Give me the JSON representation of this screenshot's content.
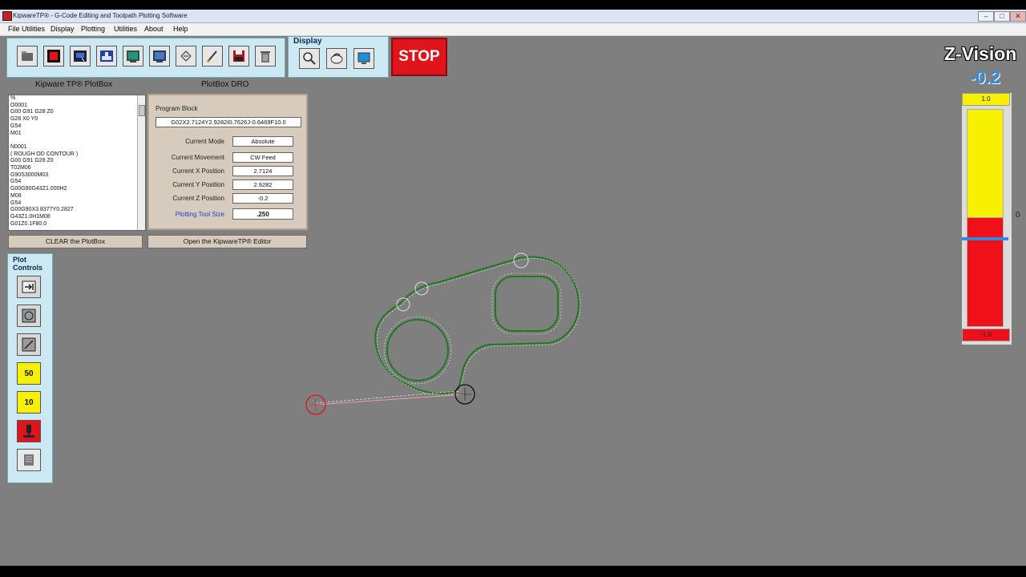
{
  "window": {
    "title": "KipwareTP® - G-Code Editing and Toolpath Plotting Software",
    "controls": [
      "–",
      "□",
      "✕"
    ]
  },
  "menu": [
    "File Utilities",
    "Display",
    "Plotting",
    "Utilities",
    "About",
    "Help"
  ],
  "toolbar": {
    "buttons": [
      "open-folder-icon",
      "red-square-icon",
      "machine-run-icon",
      "machine-view-icon",
      "monitor-icon",
      "monitor-alt-icon",
      "hand-tool-icon",
      "pen-tool-icon",
      "save-disk-icon",
      "trash-icon"
    ]
  },
  "display_group": {
    "label": "Display",
    "buttons": [
      "zoom-icon",
      "rotate-view-icon",
      "screen-icon"
    ]
  },
  "stop_button": "STOP",
  "plotbox": {
    "title": "Kipware TP® PlotBox",
    "lines": [
      "%",
      "O0001",
      "G00 G91 G28 Z0",
      "G28 X0 Y0",
      "G54",
      "M01",
      "",
      "N0001",
      "( ROUGH OD CONTOUR )",
      "G00 G91 G28 Z0",
      "T02M06",
      "G90S3000M03",
      "G54",
      "G00G90G43Z1.000H2",
      "M08",
      "G54",
      "G00G90X3.8377Y0.2827",
      "G43Z1.0H1M08",
      "G01Z0.1F80.0"
    ],
    "clear_button": "CLEAR the PlotBox"
  },
  "dro": {
    "title": "PlotBox DRO",
    "program_block_label": "Program Block",
    "program_block": "G02X2.7124Y2.9282I0.7626J-0.6469F10.0",
    "rows": [
      {
        "label": "Current Mode",
        "value": "Absolute"
      },
      {
        "label": "Current Movement",
        "value": "CW Feed"
      },
      {
        "label": "Current X Position",
        "value": "2.7124"
      },
      {
        "label": "Current Y Position",
        "value": "2.9282"
      },
      {
        "label": "Current Z Position",
        "value": "-0.2"
      }
    ],
    "tool_size_label": "Plotting Tool Size",
    "tool_size": ".250",
    "editor_button": "Open the KipwareTP® Editor"
  },
  "plot_controls": {
    "title_line1": "Plot",
    "title_line2": "Controls",
    "buttons": [
      "forward-step-icon",
      "circle-frame-icon",
      "diagonal-frame-icon",
      "step-50-icon",
      "step-10-icon",
      "tool-red-icon",
      "tool-gray-icon"
    ],
    "step_50": "50",
    "step_10": "10"
  },
  "zvision": {
    "title": "Z-Vision",
    "value": "-0.2",
    "top_label": "1.0",
    "bottom_label": "-1.0",
    "zero_label": "0",
    "z_min": -1.0,
    "z_max": 1.0,
    "z_current": -0.2
  },
  "colors": {
    "toolbar_bg": "#cbe8f3",
    "stop_red": "#e0141b",
    "toolpath_green": "#1f7a1f",
    "zvision_yellow": "#f7f100",
    "zvision_red": "#f0101a",
    "zvision_marker": "#2f8ae0"
  }
}
